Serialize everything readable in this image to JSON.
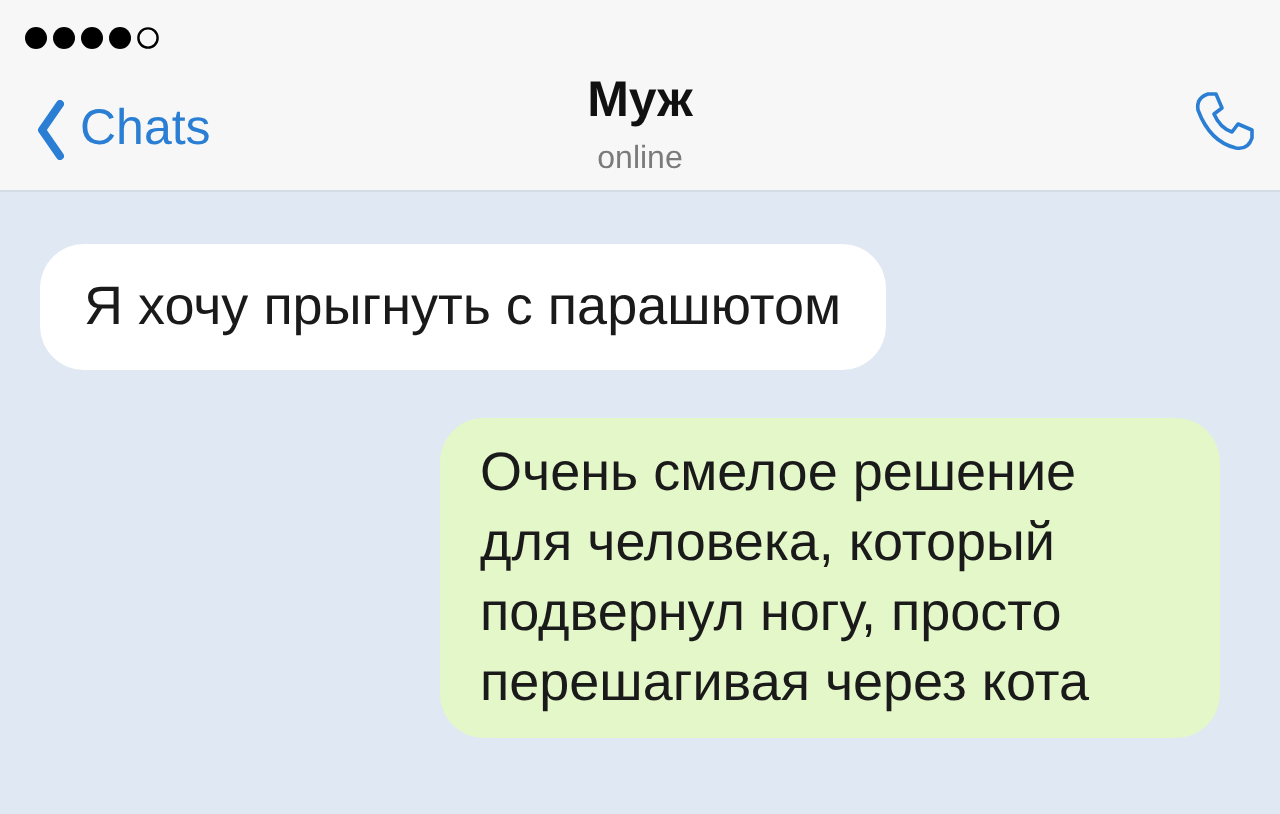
{
  "header": {
    "back": "Chats",
    "title": "Муж",
    "subtitle": "online"
  },
  "messages": [
    {
      "kind": "incoming",
      "text": "Я хочу прыгнуть с парашютом"
    },
    {
      "kind": "outgoing",
      "text": "Очень смелое решение для человека, который подвернул ногу, просто перешагивая через кота"
    }
  ]
}
